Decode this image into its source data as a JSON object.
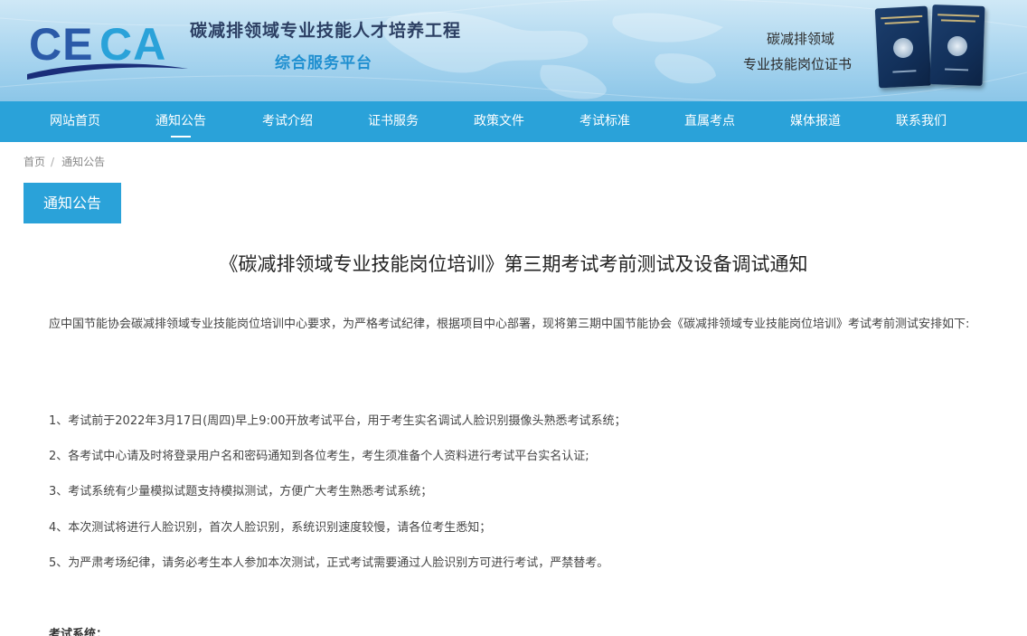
{
  "header": {
    "site_title": "碳减排领域专业技能人才培养工程",
    "site_subtitle": "综合服务平台",
    "cert_line1": "碳减排领域",
    "cert_line2": "专业技能岗位证书",
    "colors": {
      "banner": "#a9d5ef",
      "title": "#2c3f63",
      "subtitle": "#1f8fd0"
    }
  },
  "nav": {
    "items": [
      {
        "label": "网站首页"
      },
      {
        "label": "通知公告",
        "active": true
      },
      {
        "label": "考试介绍"
      },
      {
        "label": "证书服务"
      },
      {
        "label": "政策文件"
      },
      {
        "label": "考试标准"
      },
      {
        "label": "直属考点"
      },
      {
        "label": "媒体报道"
      },
      {
        "label": "联系我们"
      }
    ],
    "color": "#2aa2d9"
  },
  "breadcrumb": {
    "home": "首页",
    "sep": "/",
    "current": "通知公告"
  },
  "section_tab": "通知公告",
  "article": {
    "title": "《碳减排领域专业技能岗位培训》第三期考试考前测试及设备调试通知",
    "intro": "应中国节能协会碳减排领域专业技能岗位培训中心要求，为严格考试纪律，根据项目中心部署，现将第三期中国节能协会《碳减排领域专业技能岗位培训》考试考前测试安排如下:",
    "items": [
      "1、考试前于2022年3月17日(周四)早上9:00开放考试平台，用于考生实名调试人脸识别摄像头熟悉考试系统；",
      "2、各考试中心请及时将登录用户名和密码通知到各位考生，考生须准备个人资料进行考试平台实名认证;",
      "3、考试系统有少量模拟试题支持模拟测试，方便广大考生熟悉考试系统；",
      "4、本次测试将进行人脸识别，首次人脸识别，系统识别速度较慢，请各位考生悉知；",
      "5、为严肃考场纪律，请务必考生本人参加本次测试，正式考试需要通过人脸识别方可进行考试，严禁替考。"
    ],
    "subhead": "考试系统："
  },
  "icons": {
    "logo": "ceca-logo",
    "certificate": "certificate-book-icon"
  }
}
